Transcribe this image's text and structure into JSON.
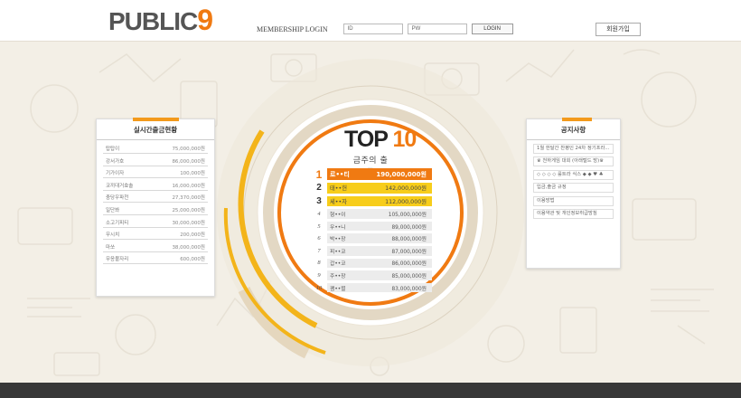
{
  "header": {
    "logo_main": "PUBLIC",
    "logo_accent": "9",
    "membership_label": "MEMBERSHIP LOGIN",
    "id_placeholder": "ID",
    "pw_placeholder": "PW",
    "login_button": "LOGIN",
    "join_button": "회원가입"
  },
  "withdrawal_panel": {
    "title": "실시간출금현황",
    "rows": [
      {
        "name": "탑탑이",
        "amount": "75,000,000원"
      },
      {
        "name": "강서가호",
        "amount": "86,000,000원"
      },
      {
        "name": "기가이자",
        "amount": "100,000원"
      },
      {
        "name": "코끼대거효솔",
        "amount": "16,000,000원"
      },
      {
        "name": "충당우파천",
        "amount": "27,370,000원"
      },
      {
        "name": "일단봐",
        "amount": "25,000,000원"
      },
      {
        "name": "소고기피티",
        "amount": "30,000,000원"
      },
      {
        "name": "무시치",
        "amount": "200,000원"
      },
      {
        "name": "마쏘",
        "amount": "38,000,000원"
      },
      {
        "name": "무응볼자리",
        "amount": "600,000원"
      }
    ]
  },
  "notice_panel": {
    "title": "공지사항",
    "items": [
      "1월 한달간 찬평인 24차 정기프라...",
      "♛ 천하게임 대회 (아래털드 방)♛",
      "◇ ◇ ◇ ◇ 룰트라 식스 ◆ ◆ ♥ ♣",
      "입금,출금 규정",
      "이용방법",
      "이용약관 및 개인정보취급방침"
    ]
  },
  "top10": {
    "title_main": "TOP",
    "title_num": "10",
    "subtitle": "금주의 출금",
    "ranks": [
      {
        "rank": "1",
        "name": "로••티",
        "amount": "190,000,000원"
      },
      {
        "rank": "2",
        "name": "태••헌",
        "amount": "142,000,000원"
      },
      {
        "rank": "3",
        "name": "세••자",
        "amount": "112,000,000원"
      },
      {
        "rank": "4",
        "name": "형••이",
        "amount": "105,000,000원"
      },
      {
        "rank": "5",
        "name": "우••니",
        "amount": "89,000,000원"
      },
      {
        "rank": "6",
        "name": "박••장",
        "amount": "88,000,000원"
      },
      {
        "rank": "7",
        "name": "피••코",
        "amount": "87,000,000원"
      },
      {
        "rank": "8",
        "name": "갑••코",
        "amount": "86,000,000원"
      },
      {
        "rank": "9",
        "name": "주••장",
        "amount": "85,000,000원"
      },
      {
        "rank": "10",
        "name": "괭••렬",
        "amount": "83,000,000원"
      }
    ]
  },
  "colors": {
    "accent_orange": "#f07a12",
    "accent_yellow": "#f7cd1b",
    "background": "#f3efe6",
    "footer": "#383838"
  }
}
